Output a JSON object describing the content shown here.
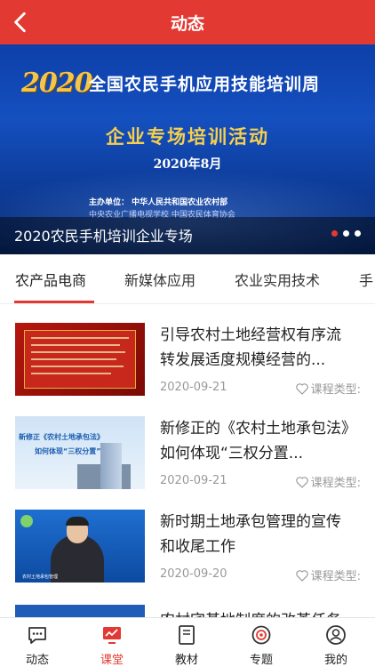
{
  "header": {
    "title": "动态"
  },
  "banner": {
    "year": "2020",
    "headline": "全国农民手机应用技能培训周",
    "subtitle": "企业专场培训活动",
    "date": "2020年8月",
    "org_line1": "主办单位： 中华人民共和国农业农村部",
    "org_line2": "中央农业广播电视学校 中国农民体育协会",
    "caption": "2020农民手机培训企业专场",
    "dots": 3,
    "active_dot": 0
  },
  "tabs": [
    {
      "label": "农产品电商"
    },
    {
      "label": "新媒体应用"
    },
    {
      "label": "农业实用技术"
    },
    {
      "label": "手"
    }
  ],
  "articles": [
    {
      "title": "引导农村土地经营权有序流转发展适度规模经营的...",
      "date": "2020-09-21",
      "type_label": "课程类型:"
    },
    {
      "title": "新修正的《农村土地承包法》如何体现“三权分置...",
      "date": "2020-09-21",
      "type_label": "课程类型:"
    },
    {
      "title": "新时期土地承包管理的宣传和收尾工作",
      "date": "2020-09-20",
      "type_label": "课程类型:"
    },
    {
      "title": "农村宅基地制度的改革任务"
    }
  ],
  "thumb_text": {
    "t2a": "新修正《农村土地承包法》",
    "t2b": "如何体现“三权分置”",
    "t3foot": "农村土地承包管理"
  },
  "bottom_nav": [
    {
      "label": "动态",
      "icon": "chat-bubble-icon"
    },
    {
      "label": "课堂",
      "icon": "monitor-chart-icon"
    },
    {
      "label": "教材",
      "icon": "book-icon"
    },
    {
      "label": "专题",
      "icon": "target-icon"
    },
    {
      "label": "我的",
      "icon": "user-icon"
    }
  ],
  "colors": {
    "primary": "#e23a33",
    "muted": "#999999"
  }
}
